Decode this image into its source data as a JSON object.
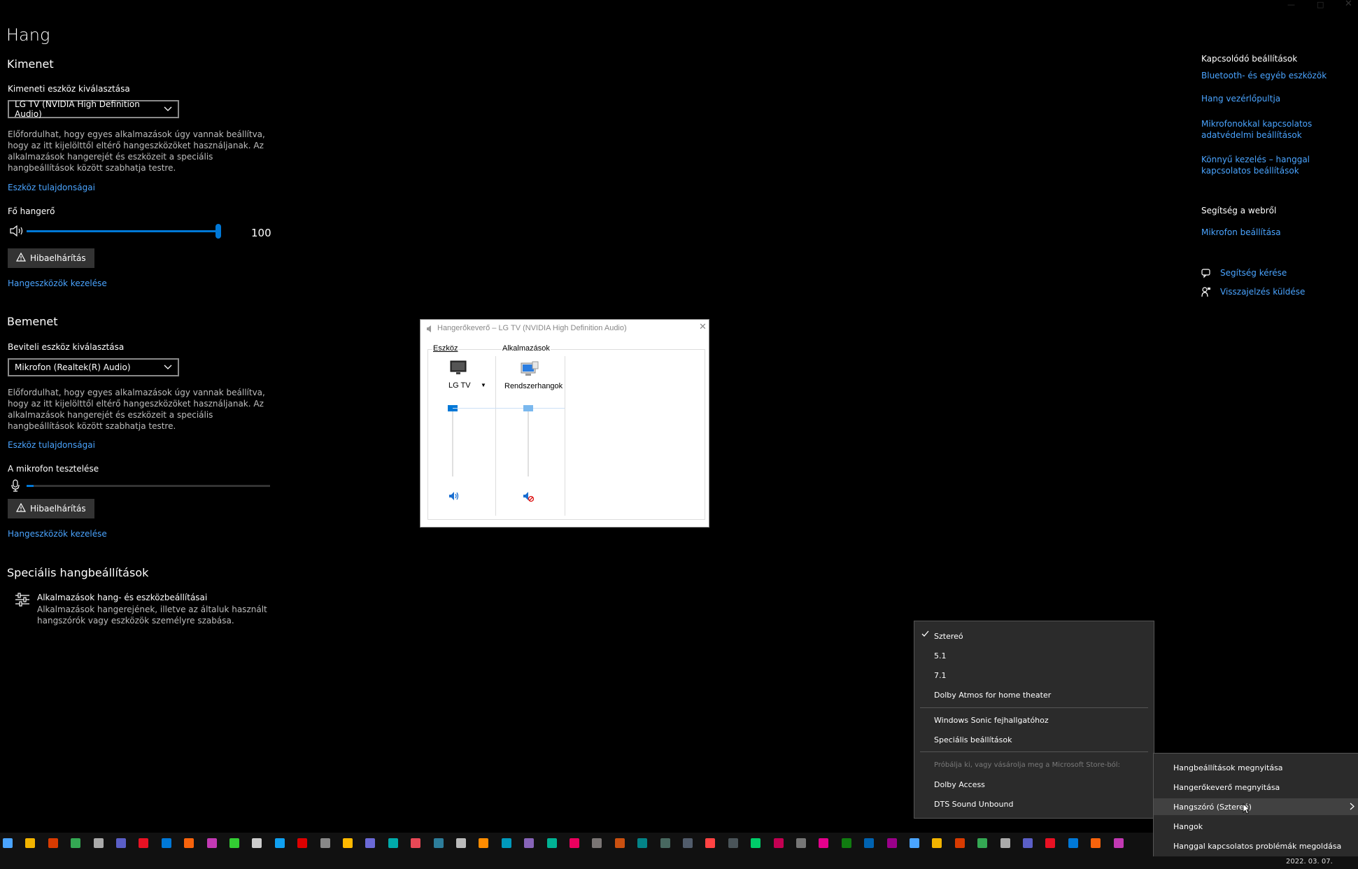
{
  "page": {
    "title": "Hang"
  },
  "output": {
    "heading": "Kimenet",
    "device_label": "Kimeneti eszköz kiválasztása",
    "device_value": "LG TV (NVIDIA High Definition Audio)",
    "description": "Előfordulhat, hogy egyes alkalmazások úgy vannak beállítva, hogy az itt kijelölttől eltérő hangeszközöket használjanak. Az alkalmazások hangerejét és eszközeit a speciális hangbeállítások között szabhatja testre.",
    "device_props_link": "Eszköz tulajdonságai",
    "volume_label": "Fő hangerő",
    "volume_value": "100",
    "volume_level": 1.0,
    "troubleshoot_label": "Hibaelhárítás",
    "manage_link": "Hangeszközök kezelése"
  },
  "input": {
    "heading": "Bemenet",
    "device_label": "Beviteli eszköz kiválasztása",
    "device_value": "Mikrofon (Realtek(R) Audio)",
    "description": "Előfordulhat, hogy egyes alkalmazások úgy vannak beállítva, hogy az itt kijelölttől eltérő hangeszközöket használjanak. Az alkalmazások hangerejét és eszközeit a speciális hangbeállítások között szabhatja testre.",
    "device_props_link": "Eszköz tulajdonságai",
    "mic_test_label": "A mikrofon tesztelése",
    "troubleshoot_label": "Hibaelhárítás",
    "manage_link": "Hangeszközök kezelése"
  },
  "advanced": {
    "heading": "Speciális hangbeállítások",
    "item_title": "Alkalmazások hang- és eszközbeállításai",
    "item_desc": "Alkalmazások hangerejének, illetve az általuk használt hangszórók vagy eszközök személyre szabása."
  },
  "related": {
    "heading": "Kapcsolódó beállítások",
    "links": [
      "Bluetooth- és egyéb eszközök",
      "Hang vezérlőpultja",
      "Mikrofonokkal kapcsolatos adatvédelmi beállítások",
      "Könnyű kezelés – hanggal kapcsolatos beállítások"
    ],
    "help_heading": "Segítség a webről",
    "help_link": "Mikrofon beállítása",
    "get_help": "Segítség kérése",
    "feedback": "Visszajelzés küldése"
  },
  "mixer": {
    "title": "Hangerőkeverő – LG TV (NVIDIA High Definition Audio)",
    "device_group": "Eszköz",
    "apps_group": "Alkalmazások",
    "device_name": "LG TV",
    "app_name": "Rendszerhangok",
    "device_level": 1.0,
    "app_level": 1.0
  },
  "spatial_menu": {
    "items": [
      "Sztereó",
      "5.1",
      "7.1",
      "Dolby Atmos for home theater"
    ],
    "items2": [
      "Windows Sonic fejhallgatóhoz",
      "Speciális beállítások"
    ],
    "store_hint": "Próbálja ki, vagy vásárolja meg a Microsoft Store-ból:",
    "store_items": [
      "Dolby Access",
      "DTS Sound Unbound"
    ]
  },
  "tray_menu": {
    "items": [
      "Hangbeállítások megnyitása",
      "Hangerőkeverő megnyitása",
      "Hangszóró (Sztereó)",
      "Hangok",
      "Hanggal kapcsolatos problémák megoldása"
    ]
  },
  "taskbar": {
    "date": "2022. 03. 07."
  },
  "colors": {
    "accent": "#0078d7",
    "link": "#4aa4ff"
  }
}
